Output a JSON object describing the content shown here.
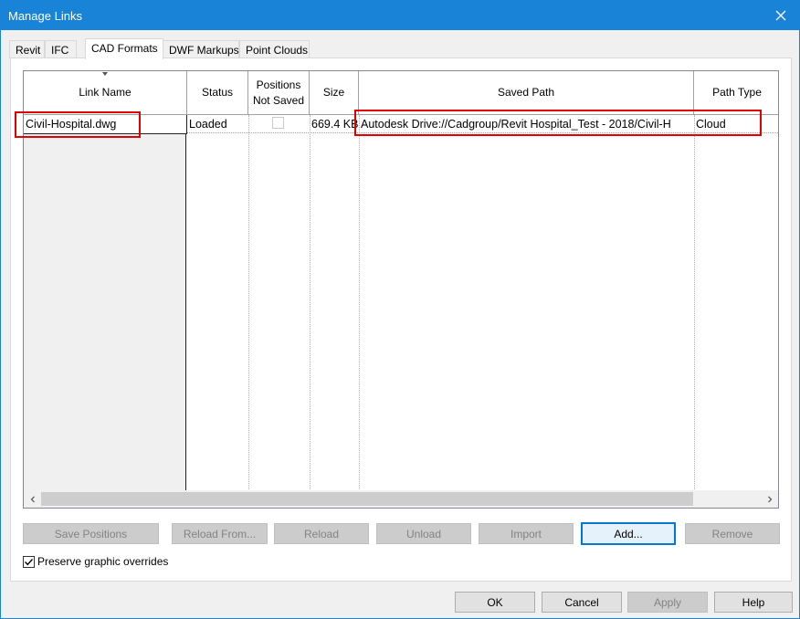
{
  "window": {
    "title": "Manage Links"
  },
  "tabs": [
    {
      "label": "Revit"
    },
    {
      "label": "IFC"
    },
    {
      "label": "CAD Formats",
      "active": true
    },
    {
      "label": "DWF Markups"
    },
    {
      "label": "Point Clouds"
    }
  ],
  "table": {
    "columns": [
      {
        "label": "Link Name"
      },
      {
        "label": "Status"
      },
      {
        "label": "Positions Not Saved"
      },
      {
        "label": "Size"
      },
      {
        "label": "Saved Path"
      },
      {
        "label": "Path Type"
      }
    ],
    "rows": [
      {
        "link_name": "Civil-Hospital.dwg",
        "status": "Loaded",
        "positions_not_saved": false,
        "size": "669.4 KB",
        "saved_path": "Autodesk Drive://Cadgroup/Revit Hospital_Test - 2018/Civil-H",
        "path_type": "Cloud"
      }
    ]
  },
  "actions": {
    "save_positions": "Save Positions",
    "reload_from": "Reload From...",
    "reload": "Reload",
    "unload": "Unload",
    "import": "Import",
    "add": "Add...",
    "remove": "Remove"
  },
  "preserve": {
    "label": "Preserve graphic overrides",
    "checked": true
  },
  "dialog_buttons": {
    "ok": "OK",
    "cancel": "Cancel",
    "apply": "Apply",
    "help": "Help"
  },
  "colors": {
    "titlebar": "#1883d7",
    "highlight": "#e00000",
    "default_button_border": "#0078d7"
  }
}
